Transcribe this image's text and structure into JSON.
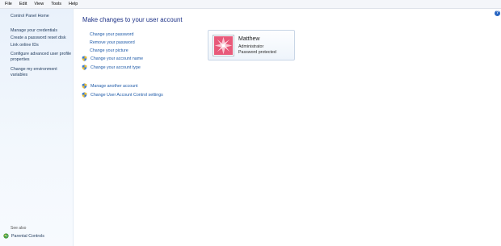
{
  "menu": [
    "File",
    "Edit",
    "View",
    "Tools",
    "Help"
  ],
  "sidebar": {
    "home": "Control Panel Home",
    "links": [
      "Manage your credentials",
      "Create a password reset disk",
      "Link online IDs",
      "Configure advanced user profile properties",
      "Change my environment variables"
    ],
    "see_also": "See also",
    "parental_controls": "Parental Controls"
  },
  "main": {
    "title": "Make changes to your user account",
    "tasks": [
      "Change your password",
      "Remove your password",
      "Change your picture",
      "Change your account name",
      "Change your account type"
    ],
    "other_tasks": [
      "Manage another account",
      "Change User Account Control settings"
    ]
  },
  "account": {
    "name": "Matthew",
    "role": "Administrator",
    "password_status": "Password protected"
  },
  "help": "?",
  "colors": {
    "link": "#1e5aa8",
    "title": "#1e3287",
    "sidebar_bg": "#e9f1fb"
  }
}
